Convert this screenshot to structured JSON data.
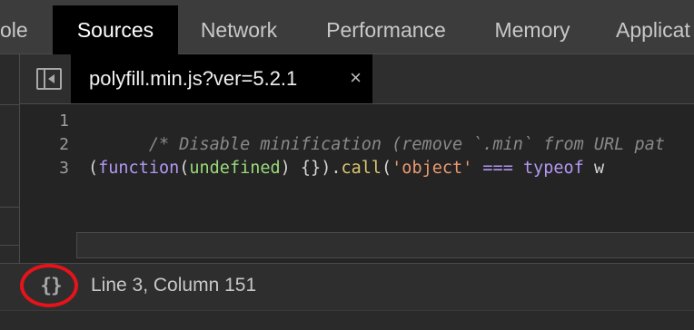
{
  "panel_tabs": {
    "console": "ole",
    "sources": "Sources",
    "network": "Network",
    "performance": "Performance",
    "memory": "Memory",
    "application": "Applicat"
  },
  "editor": {
    "file_tab_label": "polyfill.min.js?ver=5.2.1",
    "close_glyph": "×",
    "line_numbers": [
      "1",
      "2",
      "3"
    ],
    "line1_comment": "/* Disable minification (remove `.min` from URL pat",
    "line3": {
      "open_paren": "(",
      "function_kw": "function",
      "paren_open2": "(",
      "undefined_arg": "undefined",
      "paren_close_braces": ") {}).",
      "call_fn": "call",
      "paren_open3": "(",
      "str_object": "'object'",
      "op_eq": " === ",
      "typeof_kw": "typeof",
      "tail": " w"
    }
  },
  "status_bar": {
    "pretty_print_glyph": "{}",
    "position_text": "Line 3, Column 151"
  },
  "colors": {
    "highlight_ring": "#e5131a",
    "active_tab_bg": "#000000"
  }
}
